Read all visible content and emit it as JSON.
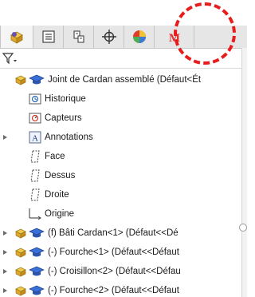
{
  "tabs": [
    {
      "name": "featuremanager-tab-icon"
    },
    {
      "name": "propertymanager-tab-icon"
    },
    {
      "name": "configurationmanager-tab-icon"
    },
    {
      "name": "dimxpert-tab-icon"
    },
    {
      "name": "display-manager-tab-icon"
    },
    {
      "name": "m-addin-tab-icon",
      "label": "M"
    }
  ],
  "filter_icon": "filter-icon",
  "tree": {
    "root": "Joint de Cardan assemblé  (Défaut<Ét",
    "history": "Historique",
    "sensors": "Capteurs",
    "annotations": "Annotations",
    "plane_face": "Face",
    "plane_top": "Dessus",
    "plane_right": "Droite",
    "origin": "Origine",
    "comp1": "(f) Bâti Cardan<1> (Défaut<<Dé",
    "comp2": "(-) Fourche<1> (Défaut<<Défaut",
    "comp3": "(-) Croisillon<2> (Défaut<<Défau",
    "comp4": "(-) Fourche<2> (Défaut<<Défaut"
  },
  "colors": {
    "callout": "#e81c1c",
    "addin_m": "#e03030"
  }
}
